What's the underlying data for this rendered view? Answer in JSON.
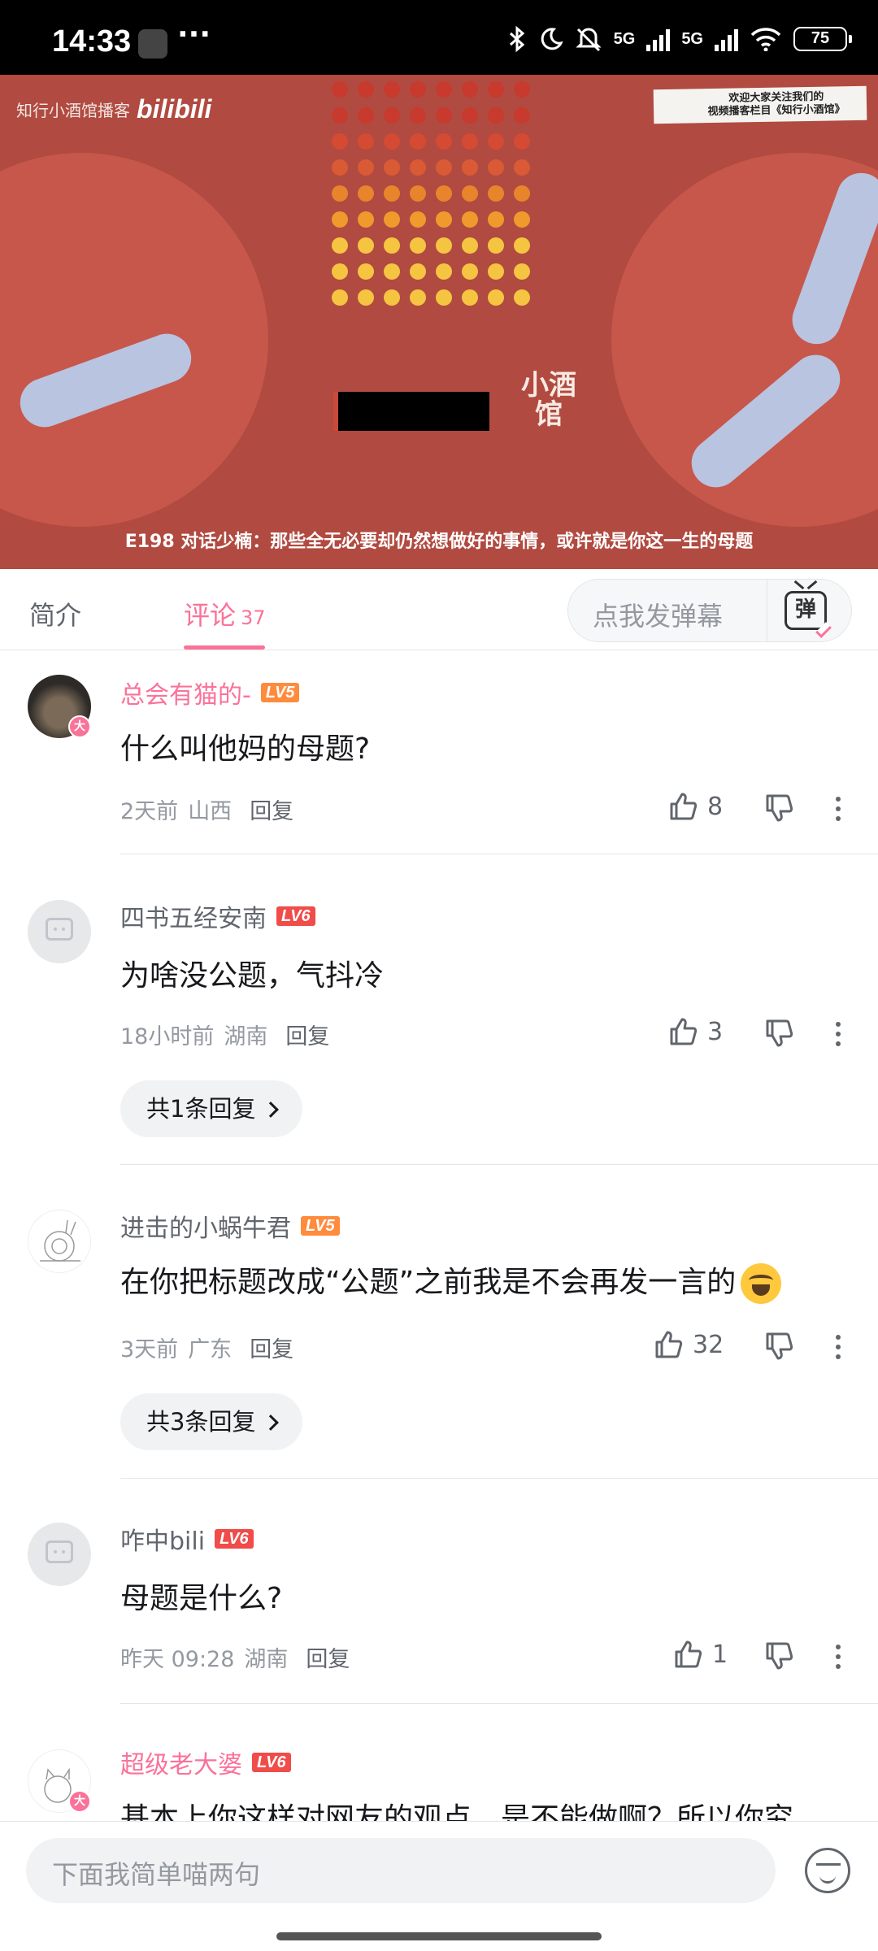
{
  "status_bar": {
    "time": "14:33",
    "net1": "5G",
    "net2": "5G",
    "battery": "75"
  },
  "video": {
    "brand_text": "知行小酒馆播客",
    "brand_logo": "bilibili",
    "notice_line1": "欢迎大家关注我们的",
    "notice_line2": "视频播客栏目《知行小酒馆》",
    "shop_logo": "小酒馆",
    "title": "E198 对话少楠：那些全无必要却仍然想做好的事情，或许就是你这一生的母题",
    "dot_colors": [
      "#c83a2e",
      "#c83a2e",
      "#d54a32",
      "#d95a34",
      "#e8842c",
      "#ef9a2c",
      "#f5c542",
      "#f5c542",
      "#f5c542"
    ]
  },
  "tabs": {
    "intro": "简介",
    "comments": "评论",
    "comments_count": "37",
    "danmaku_placeholder": "点我发弹幕",
    "danmaku_icon": "弹"
  },
  "comments": [
    {
      "username": "总会有猫的-",
      "level": "LV5",
      "text": "什么叫他妈的母题?",
      "time": "2天前",
      "location": "山西",
      "reply": "回复",
      "likes": "8"
    },
    {
      "username": "四书五经安南",
      "level": "LV6",
      "text": "为啥没公题，气抖冷",
      "time": "18小时前",
      "location": "湖南",
      "reply": "回复",
      "likes": "3",
      "replies_btn": "共1条回复"
    },
    {
      "username": "进击的小蜗牛君",
      "level": "LV5",
      "text": "在你把标题改成“公题”之前我是不会再发一言的",
      "time": "3天前",
      "location": "广东",
      "reply": "回复",
      "likes": "32",
      "replies_btn": "共3条回复"
    },
    {
      "username": "咋中bili",
      "level": "LV6",
      "text": "母题是什么?",
      "time": "昨天 09:28",
      "location": "湖南",
      "reply": "回复",
      "likes": "1"
    },
    {
      "username": "超级老大婆",
      "level": "LV6",
      "text": "基本上你这样对网友的观点，是不能做啊？所以你究"
    }
  ],
  "vip_badge": "大",
  "bottom": {
    "input_placeholder": "下面我简单喵两句"
  }
}
